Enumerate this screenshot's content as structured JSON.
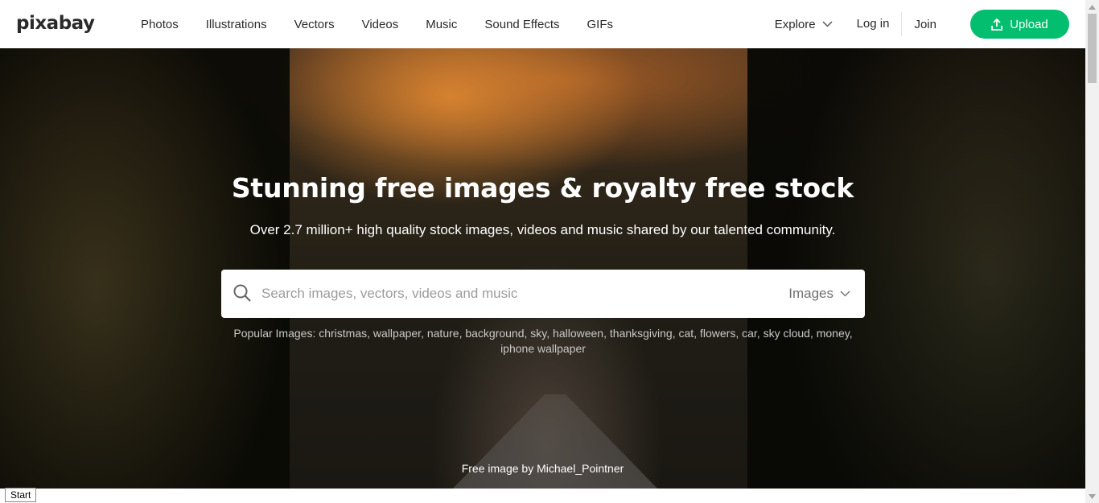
{
  "header": {
    "logo": "pixabay",
    "nav": [
      "Photos",
      "Illustrations",
      "Vectors",
      "Videos",
      "Music",
      "Sound Effects",
      "GIFs"
    ],
    "explore": "Explore",
    "login": "Log in",
    "join": "Join",
    "upload": "Upload",
    "accent_color": "#02be6e"
  },
  "hero": {
    "title": "Stunning free images & royalty free stock",
    "subtitle": "Over 2.7 million+ high quality stock images, videos and music shared by our talented community.",
    "search": {
      "placeholder": "Search images, vectors, videos and music",
      "type": "Images"
    },
    "popular_label": "Popular Images:",
    "popular": [
      "christmas",
      "wallpaper",
      "nature",
      "background",
      "sky",
      "halloween",
      "thanksgiving",
      "cat",
      "flowers",
      "car",
      "sky cloud",
      "money",
      "iphone wallpaper"
    ],
    "credit": "Free image by Michael_Pointner"
  },
  "taskbar": {
    "start": "Start"
  }
}
